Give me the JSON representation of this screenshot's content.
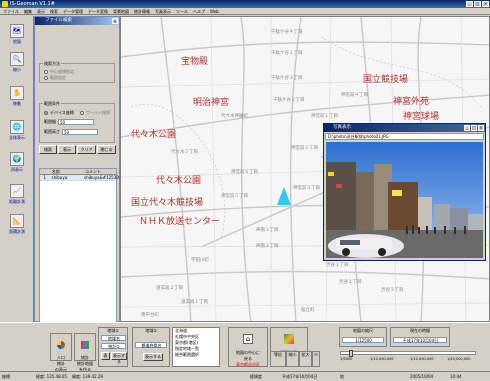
{
  "window": {
    "title": "IS-Geoman  V1.1#"
  },
  "menu": [
    "ファイル",
    "編集",
    "表示",
    "検索",
    "データ管理",
    "データ変換",
    "背景地図",
    "統計情報",
    "写真表示",
    "ツール",
    "ヘルプ",
    "Web"
  ],
  "leftbar": [
    {
      "label": "地図",
      "glyph": "🗺"
    },
    {
      "label": "縮小",
      "glyph": "🔍"
    },
    {
      "label": "移動",
      "glyph": "✋"
    },
    {
      "label": "全体表示",
      "glyph": "🌐"
    },
    {
      "label": "再表示",
      "glyph": "🌍"
    },
    {
      "label": "距離計測",
      "glyph": "📈"
    },
    {
      "label": "面積計測",
      "glyph": "📐"
    }
  ],
  "panel": {
    "title": "ファイル検索",
    "group1_label": "検索方法",
    "radio_options": [
      "中心座標指定",
      "範囲指定"
    ],
    "group2_label": "範囲条件",
    "radio_device": "デバイス座標",
    "radio_world": "ワールド座標",
    "field1_label": "範囲幅",
    "field1_value": "50",
    "field2_label": "範囲高さ",
    "field2_value": "50",
    "buttons": [
      "検索",
      "表示",
      "クリア",
      "閉じる"
    ],
    "columns": [
      "名前",
      "コメント"
    ],
    "rows": [
      {
        "no": "1",
        "name": "shibuya",
        "comment": "shibuya&#12539;"
      }
    ]
  },
  "map": {
    "landmarks": [
      {
        "text": "宝物殿"
      },
      {
        "text": "明治神宮"
      },
      {
        "text": "国立競技場"
      },
      {
        "text": "神宮外苑"
      },
      {
        "text": "神宮球場"
      },
      {
        "text": "代々木公園"
      },
      {
        "text": "代々木公園"
      },
      {
        "text": "国立代々木競技場"
      },
      {
        "text": "ＮＨＫ放送センター"
      }
    ],
    "towns": [
      {
        "text": "千駄ケ谷４丁目"
      },
      {
        "text": "千駄ケ谷１丁目"
      },
      {
        "text": "千駄ケ谷３丁目"
      },
      {
        "text": "千駄ケ谷２丁目"
      },
      {
        "text": "代々木神園町"
      },
      {
        "text": "神宮前１丁目"
      },
      {
        "text": "神宮前２丁目"
      },
      {
        "text": "神宮前３丁目"
      },
      {
        "text": "代々木５丁目"
      },
      {
        "text": "宇田川町"
      },
      {
        "text": "神南１丁目"
      },
      {
        "text": "神南２丁目"
      },
      {
        "text": "渋谷１丁目"
      },
      {
        "text": "渋谷２丁目"
      },
      {
        "text": "道玄坂２丁目"
      },
      {
        "text": "道玄坂１丁目"
      },
      {
        "text": "桜丘町"
      },
      {
        "text": "神宮前６丁目"
      },
      {
        "text": "神宮前５丁目"
      },
      {
        "text": "神宮前４丁目"
      },
      {
        "text": "渋谷３丁目"
      },
      {
        "text": "南平台町"
      }
    ],
    "marker_color": "#33c8f0"
  },
  "photo": {
    "title": "写真表示",
    "path": "D:\\photo\\渋谷駅前\\photo01.JPG"
  },
  "bottom": {
    "box_open": "人口\n統計\nの表示",
    "box_chart": "統計\n統計地図\nを作る",
    "area_label": "地域①",
    "area_sel1": "地域名",
    "area_sel2": "統計①",
    "area_btn1": "表",
    "area_btn2": "表示する",
    "pref_label": "地域②",
    "pref_sel": "都道府県名",
    "pref_btn": "表示する",
    "pref_list": [
      "北海道",
      "札幌市中央区",
      "東京都(港区)",
      "指定地域一覧",
      "総合範囲選択"
    ],
    "return_label": "地図の中心に\n戻る",
    "return_text": "東京都渋谷区",
    "aerial_label": "背景地図\nの表示",
    "zoom_labels": [
      "縮小",
      "拡大",
      "Ｈ"
    ],
    "scale_label": "地図の縮尺",
    "scale_value": "1/12500",
    "zoom_in_label": "等倍",
    "loupe_label": "拡大",
    "date_label": "現在の時間",
    "date_value": "平成17年10月04日",
    "scale_ticks": [
      "1/5000",
      "1/10,000,000",
      "1/10,000,000",
      "1/25,000,000"
    ]
  },
  "status": {
    "pos": "座標",
    "coord1": "経度: 135.48.05",
    "coord2": "緯度: 139.42.29",
    "mode": "経緯度",
    "date": "平成17年10月04日",
    "extra": "地",
    "date2": "2005/10/04",
    "time": "10:44"
  }
}
